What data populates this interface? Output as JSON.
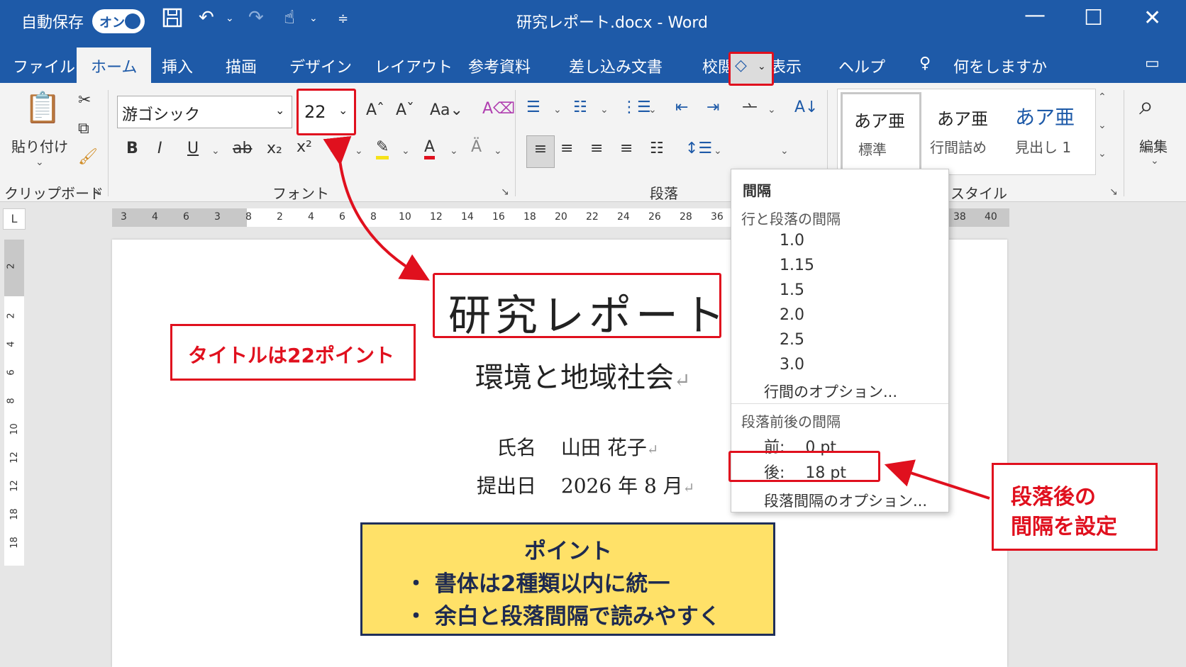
{
  "window": {
    "autosave_label": "自動保存",
    "autosave_state": "オン",
    "title": "研究レポート.docx  -  Word"
  },
  "tabs": [
    "ファイル",
    "ホーム",
    "挿入",
    "描画",
    "デザイン",
    "レイアウト",
    "参考資料",
    "差し込み文書",
    "校閲",
    "表示",
    "ヘルプ"
  ],
  "active_tab": "ホーム",
  "tell_me": "何をしますか",
  "ribbon": {
    "paste_label": "貼り付け",
    "clipboard_group": "クリップボード",
    "font_name": "游ゴシック",
    "font_size": "22",
    "font_group": "フォント",
    "paragraph_group": "段落",
    "styles_group": "スタイル",
    "styles": [
      {
        "sample": "あア亜",
        "name": "標準"
      },
      {
        "sample": "あア亜",
        "name": "行間詰め"
      },
      {
        "sample": "あア亜",
        "name": "見出し 1"
      }
    ],
    "editing_label": "編集",
    "font_buttons": {
      "bold": "B",
      "italic": "I",
      "underline": "U",
      "strike": "ab",
      "sub": "x₂",
      "sup": "x²",
      "grow": "A^",
      "shrink": "Aˇ",
      "case": "Aa",
      "clear": "A"
    }
  },
  "ruler": {
    "h_numbers": [
      "3",
      "4",
      "6",
      "3",
      "8",
      "2",
      "4",
      "6",
      "8",
      "10",
      "12",
      "14",
      "16",
      "18",
      "20",
      "22",
      "24",
      "26",
      "28",
      "36",
      "38",
      "40"
    ],
    "tab_selector": "L",
    "v_numbers": [
      "2",
      "2",
      "4",
      "6",
      "8",
      "10",
      "12",
      "12",
      "18",
      "18"
    ]
  },
  "document": {
    "title": "研究レポート",
    "subtitle": "環境と地域社会",
    "name_label": "氏名",
    "name_value": "山田 花子",
    "date_label": "提出日",
    "date_value": "2026 年 8 月"
  },
  "callouts": {
    "title_size": "タイトルは22ポイント",
    "after_spacing_line1": "段落後の",
    "after_spacing_line2": "間隔を設定"
  },
  "note": {
    "heading": "ポイント",
    "bullets": [
      "・ 書体は2種類以内に統一",
      "・ 余白と段落間隔で読みやすく"
    ]
  },
  "spacing_menu": {
    "title": "間隔",
    "line_section": "行と段落の間隔",
    "line_options": [
      "1.0",
      "1.15",
      "1.5",
      "2.0",
      "2.5",
      "3.0"
    ],
    "line_more": "行間のオプション...",
    "para_section": "段落前後の間隔",
    "before_label": "前:",
    "before_value": "0 pt",
    "after_label": "後:",
    "after_value": "18 pt",
    "para_more": "段落間隔のオプション..."
  },
  "colors": {
    "titlebar": "#1e5aa8",
    "highlight_red": "#e0101e",
    "note_fill": "#ffe168",
    "note_border": "#1f2f5a"
  }
}
